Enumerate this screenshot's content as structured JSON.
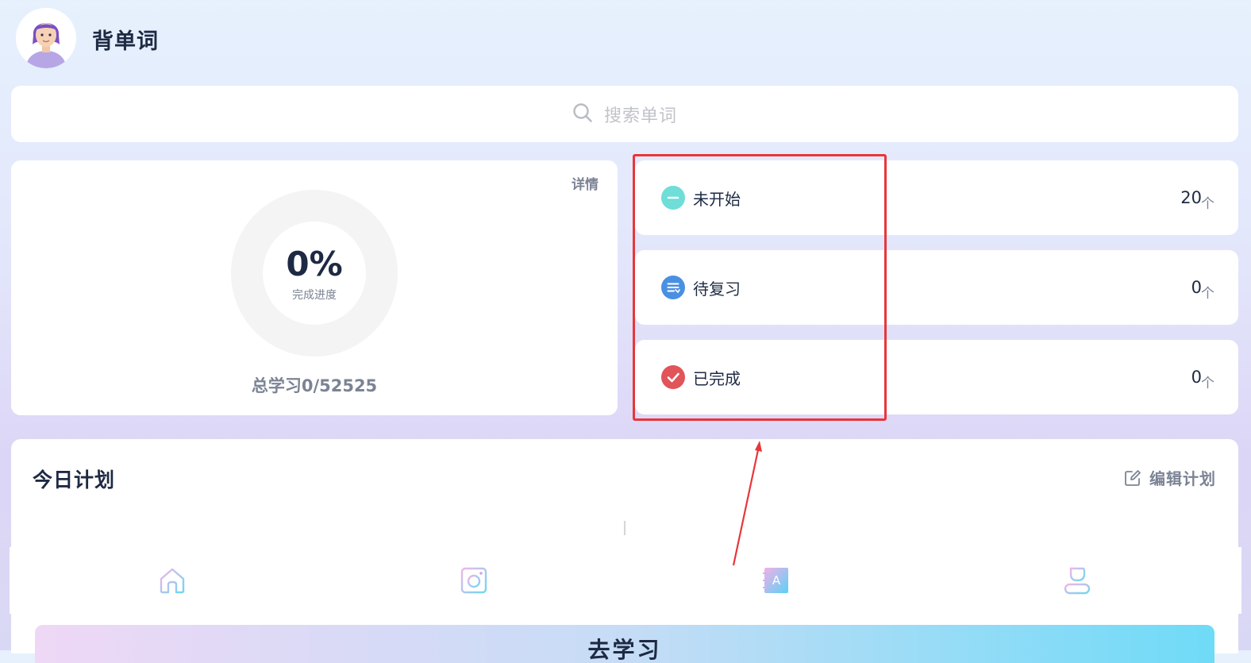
{
  "header": {
    "title": "背单词"
  },
  "search": {
    "placeholder": "搜索单词"
  },
  "progress": {
    "details_label": "详情",
    "percent_text": "0%",
    "percent_value": 0,
    "percent_label": "完成进度",
    "total_study": "总学习0/52525"
  },
  "status_items": [
    {
      "label": "未开始",
      "count": "20",
      "unit": "个",
      "color": "#6fddd8",
      "icon": "minus-icon"
    },
    {
      "label": "待复习",
      "count": "0",
      "unit": "个",
      "color": "#4a90e2",
      "icon": "list-icon"
    },
    {
      "label": "已完成",
      "count": "0",
      "unit": "个",
      "color": "#e0545a",
      "icon": "check-icon"
    }
  ],
  "plan": {
    "title": "今日计划",
    "edit_label": "编辑计划"
  },
  "tabs": [
    {
      "icon": "home-icon"
    },
    {
      "icon": "camera-icon"
    },
    {
      "icon": "dictionary-icon"
    },
    {
      "icon": "profile-icon"
    }
  ],
  "start_button": {
    "label": "去学习"
  },
  "colors": {
    "highlight": "#e8363a",
    "text_primary": "#1e2a44",
    "text_secondary": "#7b8394"
  }
}
